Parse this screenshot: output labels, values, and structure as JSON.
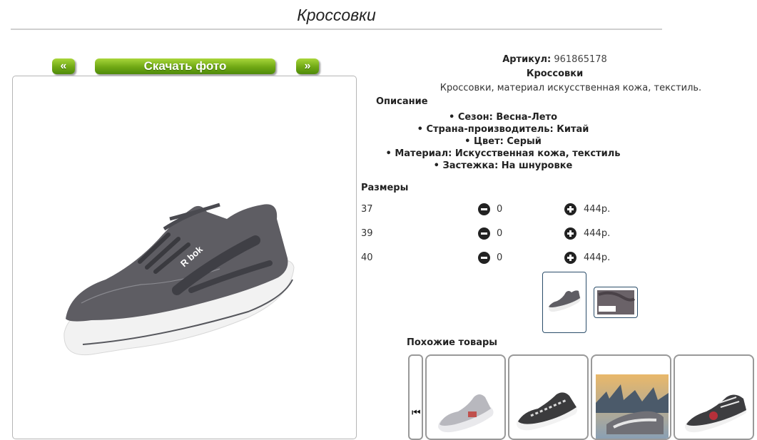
{
  "page": {
    "title": "Кроссовки"
  },
  "gallery": {
    "prev_label": "«",
    "download_label": "Скачать фото",
    "next_label": "»"
  },
  "product": {
    "article_label": "Артикул:",
    "article_value": "961865178",
    "name": "Кроссовки",
    "short_description": "Кроссовки, материал искусственная кожа, текстиль.",
    "description_heading": "Описание",
    "specs": [
      "Сезон: Весна-Лето",
      "Страна-производитель: Китай",
      "Цвет: Серый",
      "Материал: Искусственная кожа, текстиль",
      "Застежка: На шнуровке"
    ]
  },
  "sizes": {
    "heading": "Размеры",
    "rows": [
      {
        "size": "37",
        "qty": "0",
        "price": "444р."
      },
      {
        "size": "39",
        "qty": "0",
        "price": "444р."
      },
      {
        "size": "40",
        "qty": "0",
        "price": "444р."
      }
    ]
  },
  "similar": {
    "heading": "Похожие товары",
    "prev_icon": "skip-back-icon"
  },
  "colors": {
    "button_green": "#6fa814",
    "thumb_border": "#2b4d6a"
  }
}
